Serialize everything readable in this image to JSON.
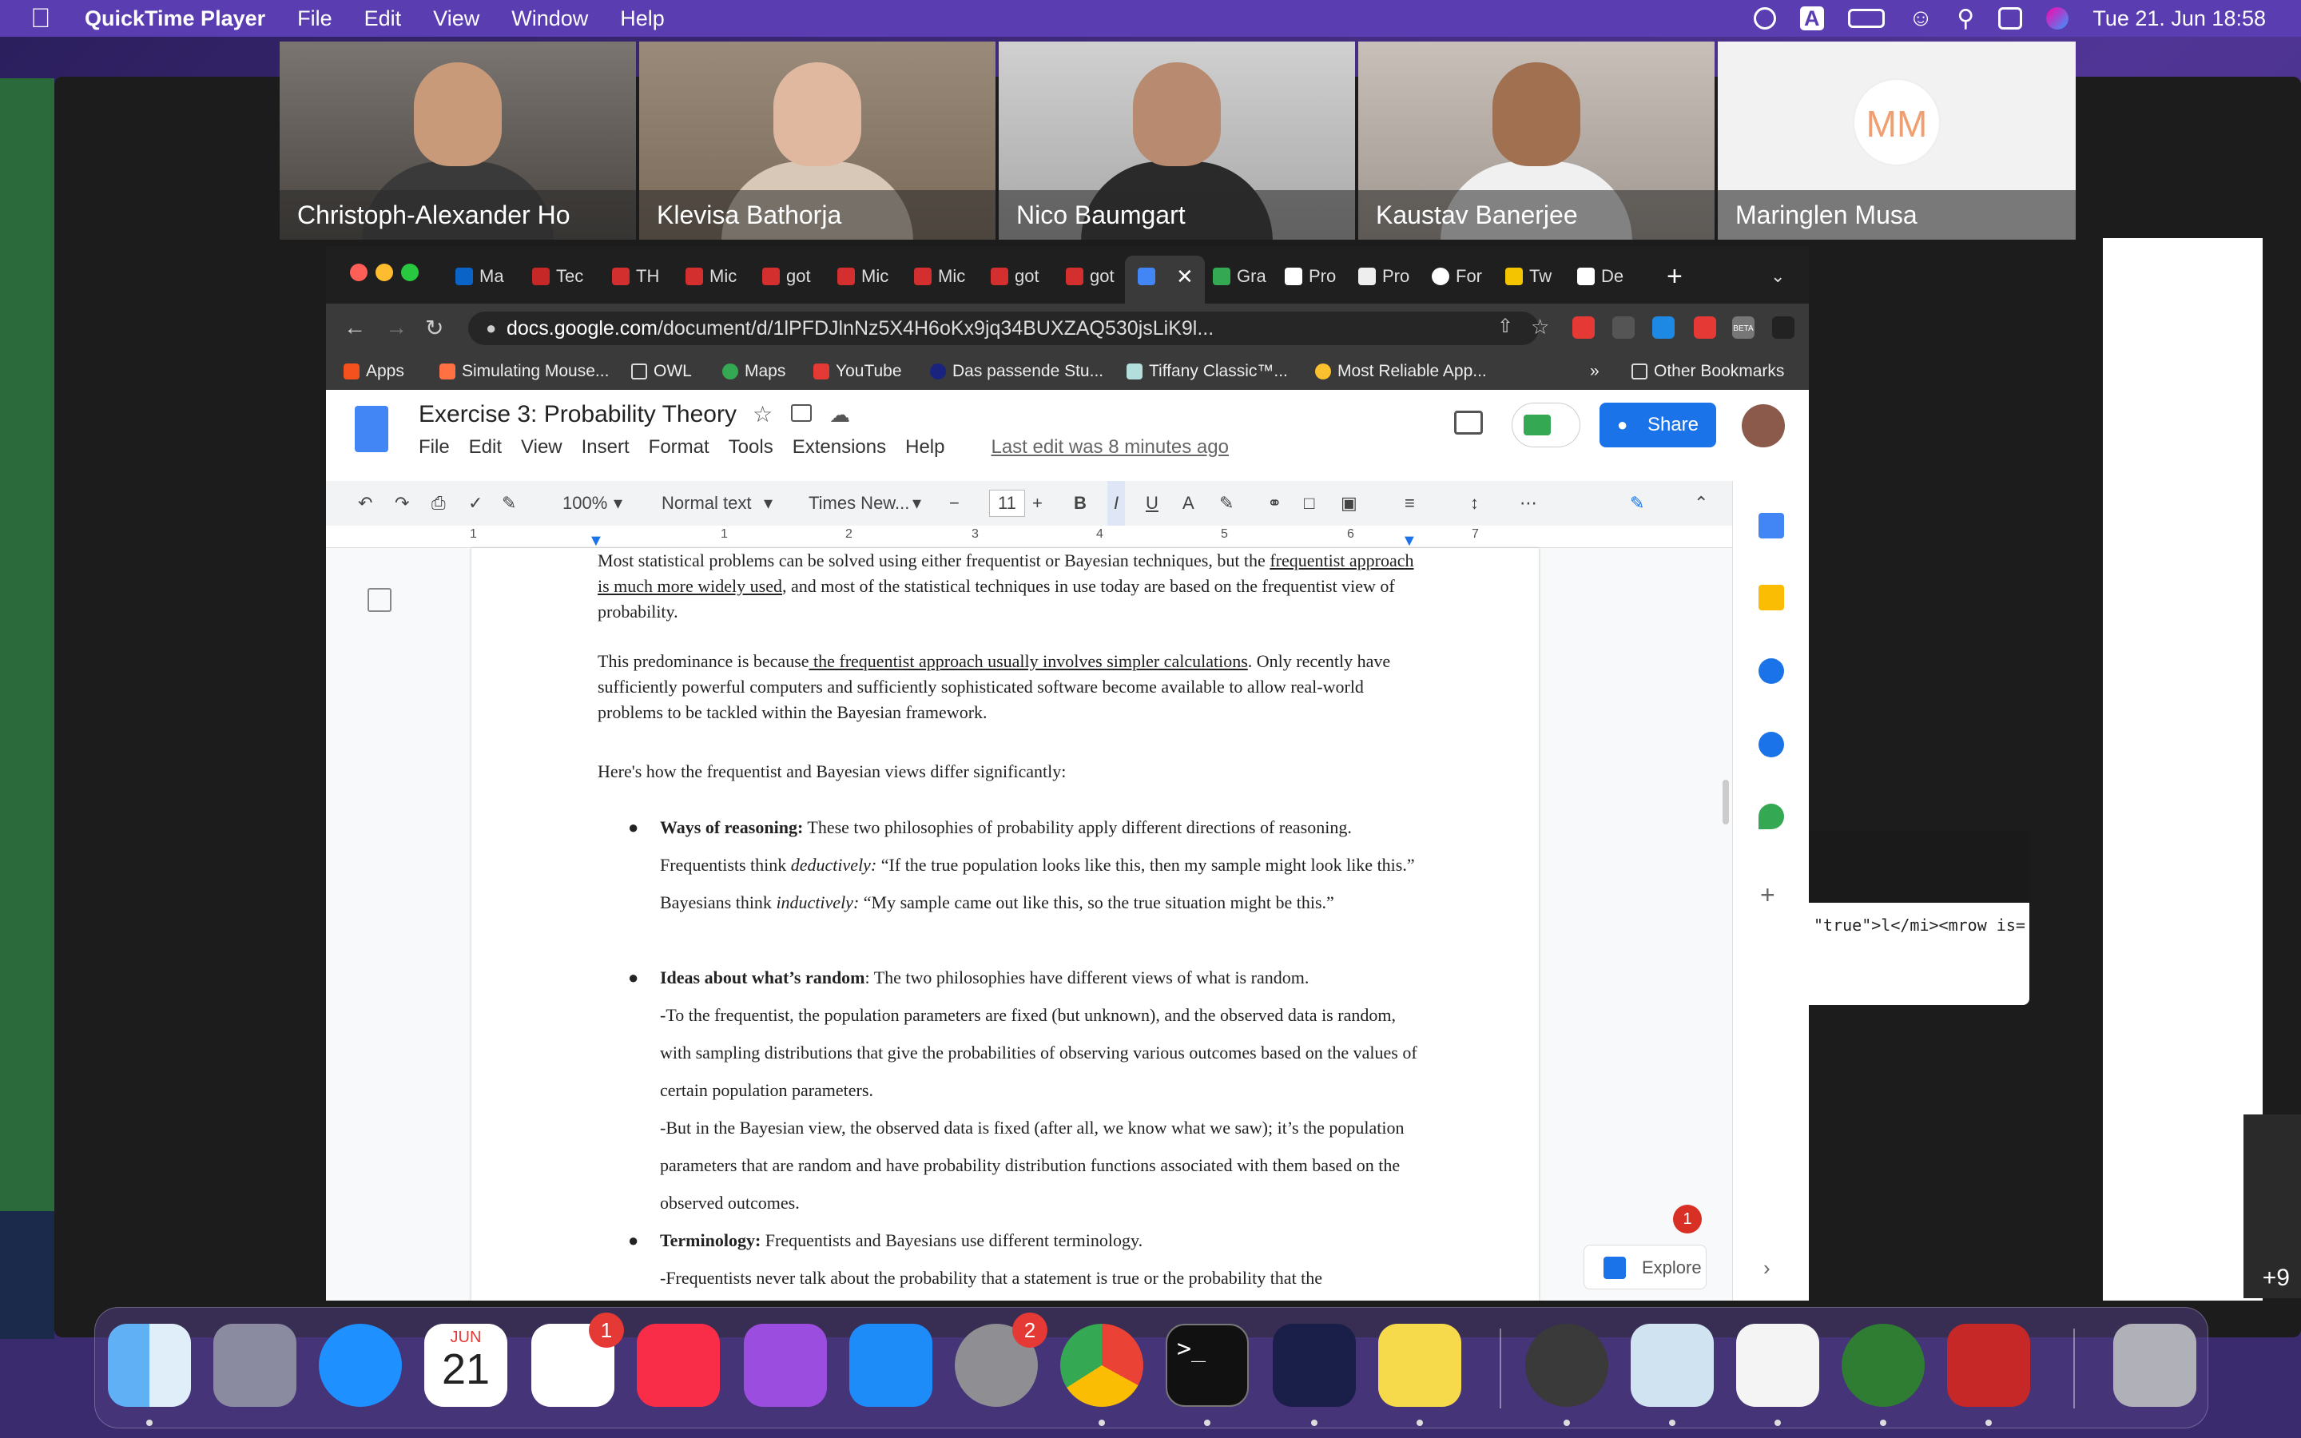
{
  "menubar": {
    "app_name": "QuickTime Player",
    "menus": [
      "File",
      "Edit",
      "View",
      "Window",
      "Help"
    ],
    "datetime": "Tue 21. Jun  18:58",
    "letter_icon": "A"
  },
  "participants": [
    {
      "name": "Christoph-Alexander Ho"
    },
    {
      "name": "Klevisa Bathorja"
    },
    {
      "name": "Nico Baumgart"
    },
    {
      "name": "Kaustav Banerjee"
    },
    {
      "name": "Maringlen Musa",
      "initials": "MM"
    }
  ],
  "more_participants": "+9",
  "browser": {
    "tabs": [
      {
        "label": "Ma"
      },
      {
        "label": "Tec"
      },
      {
        "label": "TH"
      },
      {
        "label": "Mic"
      },
      {
        "label": "got"
      },
      {
        "label": "Mic"
      },
      {
        "label": "Mic"
      },
      {
        "label": "got"
      },
      {
        "label": "got"
      },
      {
        "label": ""
      },
      {
        "label": "Gra"
      },
      {
        "label": "Pro"
      },
      {
        "label": "Pro"
      },
      {
        "label": "For"
      },
      {
        "label": "Tw"
      },
      {
        "label": "De"
      }
    ],
    "url_domain": "docs.google.com",
    "url_path": "/document/d/1lPFDJlnNz5X4H6oKx9jq34BUXZAQ530jsLiK9l...",
    "beta_label": "BETA",
    "bookmarks": [
      "Apps",
      "Simulating Mouse...",
      "OWL",
      "Maps",
      "YouTube",
      "Das passende Stu...",
      "Tiffany Classic™...",
      "Most Reliable App..."
    ],
    "other_bookmarks": "Other Bookmarks"
  },
  "docs": {
    "title": "Exercise 3: Probability Theory",
    "menus": [
      "File",
      "Edit",
      "View",
      "Insert",
      "Format",
      "Tools",
      "Extensions",
      "Help"
    ],
    "last_edit": "Last edit was 8 minutes ago",
    "share_label": "Share",
    "toolbar": {
      "zoom": "100%",
      "style": "Normal text",
      "font": "Times New...",
      "font_size": "11"
    },
    "ruler": [
      "1",
      "1",
      "2",
      "3",
      "4",
      "5",
      "6",
      "7"
    ],
    "explore_label": "Explore",
    "notification_count": "1",
    "body": {
      "p1a": "Most statistical problems can be solved using either frequentist or Bayesian techniques, but the ",
      "p1u": "frequentist approach is much more widely used",
      "p1b": ", and most of the statistical techniques in use today are based on the frequentist view of probability.",
      "p2a": "This predominance is because",
      "p2u": " the frequentist approach usually involves simpler calculations",
      "p2b": ". Only recently have sufficiently powerful computers and sufficiently sophisticated software become available to allow real-world problems to be tackled within the Bayesian framework.",
      "p3": "Here's how the frequentist and Bayesian views differ significantly:",
      "b1_title": "Ways of reasoning:",
      "b1_a": " These two philosophies of probability apply different directions of reasoning. Frequentists think ",
      "b1_i1": "deductively:",
      "b1_b": " “If the true population looks like this, then my sample might look like this.” Bayesians think ",
      "b1_i2": "inductively:",
      "b1_c": " “My sample came out like this, so the true situation might be this.”",
      "b2_title": "Ideas about what’s random",
      "b2_a": ": The two philosophies have different views of what is random.",
      "b2_l1": "-To the frequentist, the population parameters are fixed (but unknown), and the observed data is random, with sampling distributions that give the probabilities of observing various outcomes based on the values of certain population parameters.",
      "b2_l2": "-But in the Bayesian view, the observed data is fixed (after all, we know what we saw); it’s the population parameters that are random and have probability distribution functions associated with them based on the observed outcomes.",
      "b3_title": "Terminology:",
      "b3_a": " Frequentists and Bayesians use different terminology.",
      "b3_l1": "-Frequentists never talk about the probability that a statement is true or the probability that the"
    }
  },
  "popup_code": "\"true\">l</mi><mrow is=",
  "dock": {
    "calendar_month": "JUN",
    "calendar_day": "21",
    "reminders_badge": "1",
    "settings_badge": "2",
    "terminal_prompt": ">_"
  }
}
